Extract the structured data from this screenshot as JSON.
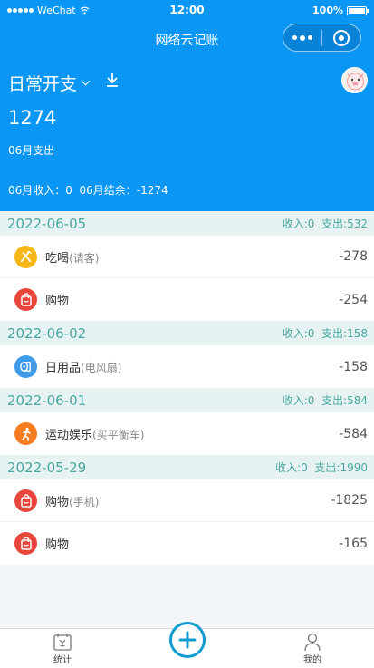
{
  "status_bar": {
    "carrier": "WeChat",
    "time": "12:00",
    "battery": "100%"
  },
  "nav": {
    "title": "网络云记账"
  },
  "header": {
    "type_label": "日常开支",
    "amount": "1274",
    "amount_label": "06月支出",
    "summary": "06月收入：0  06月结余：-1274"
  },
  "days": [
    {
      "date": "2022-06-05",
      "summary": "收入:0  支出:532",
      "items": [
        {
          "icon": "utensils-icon",
          "color": "#f7b718",
          "name": "吃喝",
          "note": "(请客)",
          "amount": "-278"
        },
        {
          "icon": "shopping-bag-icon",
          "color": "#e8453c",
          "name": "购物",
          "note": "",
          "amount": "-254"
        }
      ]
    },
    {
      "date": "2022-06-02",
      "summary": "收入:0  支出:158",
      "items": [
        {
          "icon": "toilet-paper-icon",
          "color": "#3d9be9",
          "name": "日用品",
          "note": "(电风扇)",
          "amount": "-158"
        }
      ]
    },
    {
      "date": "2022-06-01",
      "summary": "收入:0  支出:584",
      "items": [
        {
          "icon": "running-icon",
          "color": "#f57c1f",
          "name": "运动娱乐",
          "note": "(买平衡车)",
          "amount": "-584"
        }
      ]
    },
    {
      "date": "2022-05-29",
      "summary": "收入:0  支出:1990",
      "items": [
        {
          "icon": "shopping-bag-icon",
          "color": "#e8453c",
          "name": "购物",
          "note": "(手机)",
          "amount": "-1825"
        },
        {
          "icon": "shopping-bag-icon",
          "color": "#e8453c",
          "name": "购物",
          "note": "",
          "amount": "-165"
        }
      ]
    }
  ],
  "tabbar": {
    "stats_label": "统计",
    "mine_label": "我的"
  },
  "colors": {
    "header_bg": "#0a96f5",
    "day_head_bg": "#e7f3f3",
    "day_head_text": "#4aa7a1",
    "add_button": "#119ccf"
  }
}
